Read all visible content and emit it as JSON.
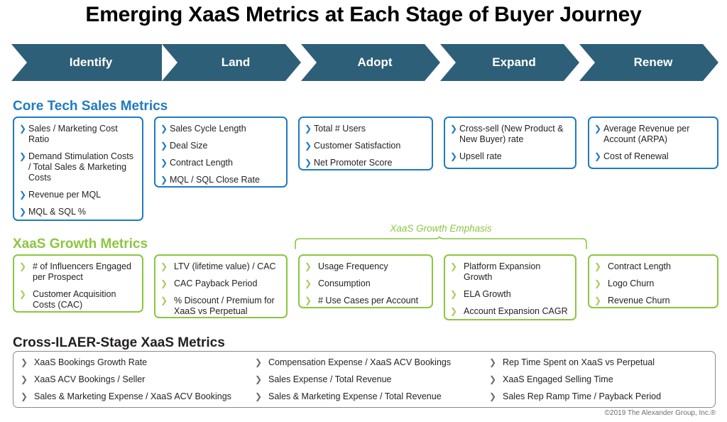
{
  "title": "Emerging XaaS Metrics at Each Stage of Buyer Journey",
  "colors": {
    "banner": "#2e5f78",
    "blue": "#1f7bc1",
    "green": "#8cc63f",
    "gray": "#8a8a8a"
  },
  "stages": [
    {
      "label": "Identify"
    },
    {
      "label": "Land"
    },
    {
      "label": "Adopt"
    },
    {
      "label": "Expand"
    },
    {
      "label": "Renew"
    }
  ],
  "sections": {
    "core": {
      "title": "Core Tech Sales Metrics",
      "columns": [
        {
          "items": [
            "Sales / Marketing Cost Ratio",
            "Demand Stimulation Costs / Total Sales & Marketing Costs",
            "Revenue per MQL",
            "MQL & SQL %"
          ]
        },
        {
          "items": [
            "Sales Cycle Length",
            "Deal Size",
            "Contract Length",
            "MQL / SQL Close Rate"
          ]
        },
        {
          "items": [
            "Total # Users",
            "Customer Satisfaction",
            "Net Promoter Score"
          ]
        },
        {
          "items": [
            "Cross-sell (New Product & New Buyer) rate",
            "Upsell rate"
          ]
        },
        {
          "items": [
            "Average Revenue per Account (ARPA)",
            "Cost of Renewal"
          ]
        }
      ]
    },
    "growth": {
      "title": "XaaS Growth Metrics",
      "emphasis_label": "XaaS Growth Emphasis",
      "columns": [
        {
          "items": [
            "# of Influencers Engaged per Prospect",
            "Customer Acquisition Costs (CAC)"
          ]
        },
        {
          "items": [
            "LTV (lifetime value)  / CAC",
            "CAC Payback Period",
            "% Discount / Premium for XaaS vs Perpetual"
          ]
        },
        {
          "items": [
            "Usage Frequency",
            "Consumption",
            "# Use Cases per Account"
          ]
        },
        {
          "items": [
            "Platform Expansion Growth",
            "ELA Growth",
            "Account Expansion CAGR"
          ]
        },
        {
          "items": [
            "Contract Length",
            "Logo Churn",
            "Revenue Churn"
          ]
        }
      ]
    },
    "cross": {
      "title": "Cross-ILAER-Stage XaaS Metrics",
      "columns": [
        {
          "items": [
            "XaaS Bookings Growth Rate",
            "XaaS ACV Bookings / Seller",
            "Sales & Marketing Expense / XaaS ACV Bookings"
          ]
        },
        {
          "items": [
            "Compensation Expense / XaaS ACV Bookings",
            "Sales Expense / Total Revenue",
            "Sales & Marketing Expense / Total Revenue"
          ]
        },
        {
          "items": [
            "Rep Time Spent on XaaS vs Perpetual",
            "XaaS Engaged Selling Time",
            "Sales Rep Ramp Time / Payback Period"
          ]
        }
      ]
    }
  },
  "footer": "©2019 The Alexander Group, Inc.®",
  "chevron_glyph": "❯"
}
